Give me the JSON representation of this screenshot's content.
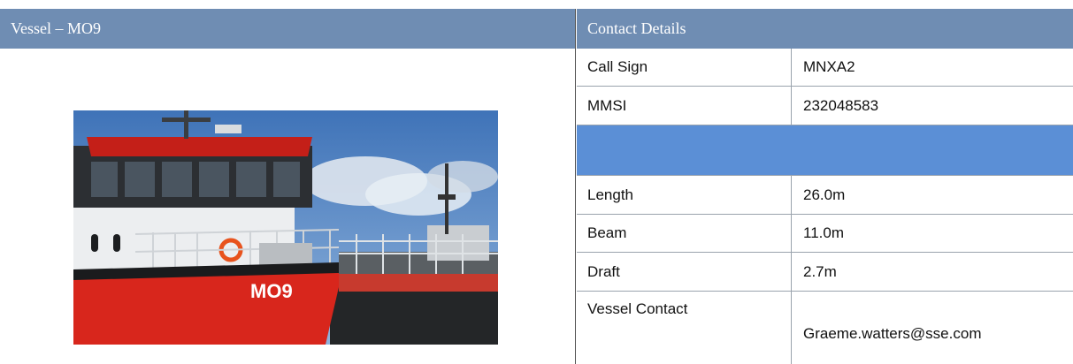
{
  "left_panel": {
    "title": "Vessel – MO9",
    "photo": {
      "hull_marking": "MO9"
    }
  },
  "right_panel": {
    "title": "Contact Details",
    "rows": [
      {
        "label": "Call Sign",
        "value": "MNXA2"
      },
      {
        "label": "MMSI",
        "value": "232048583"
      },
      {
        "label": "",
        "value": ""
      },
      {
        "label": "Length",
        "value": "26.0m"
      },
      {
        "label": "Beam",
        "value": "11.0m"
      },
      {
        "label": "Draft",
        "value": "2.7m"
      },
      {
        "label": "Vessel Contact",
        "value": "Graeme.watters@sse.com"
      }
    ]
  },
  "colors": {
    "header_bg": "#6f8db3",
    "separator_row": "#5b8fd6",
    "hull_red": "#d8261c"
  }
}
